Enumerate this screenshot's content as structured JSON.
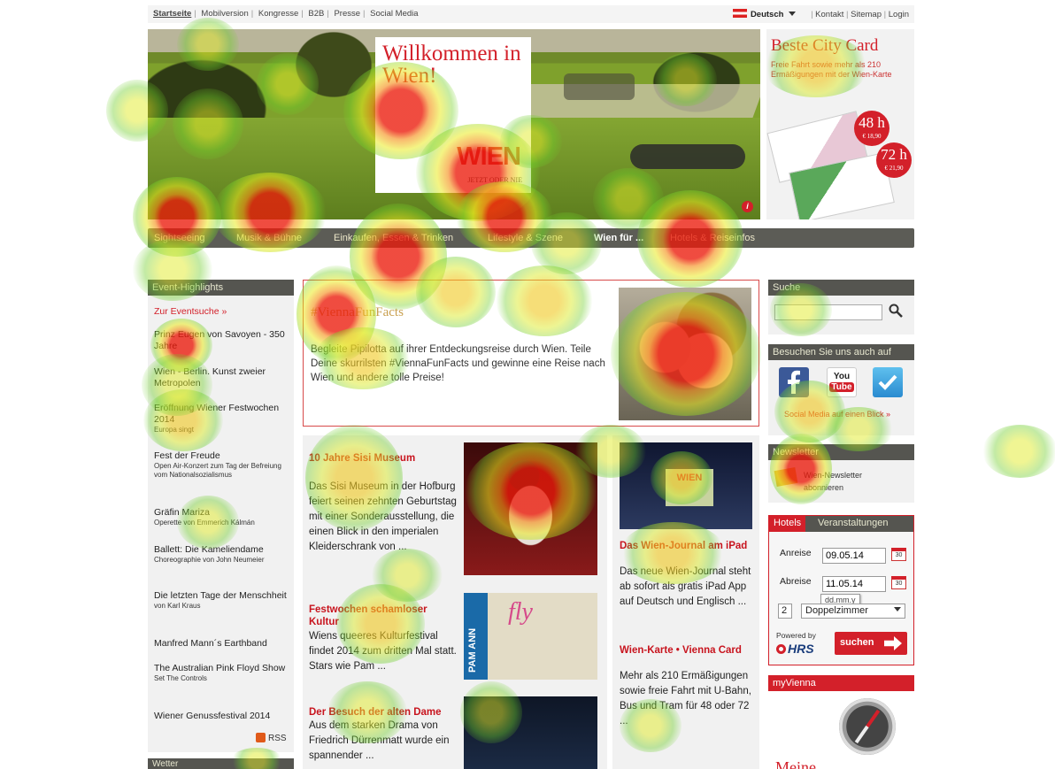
{
  "topbar": {
    "links_left": [
      "Startseite",
      "Mobilversion",
      "Kongresse",
      "B2B",
      "Presse",
      "Social Media"
    ],
    "language": "Deutsch",
    "links_right": [
      "Kontakt",
      "Sitemap",
      "Login"
    ]
  },
  "hero": {
    "welcome_title": "Willkommen in Wien!",
    "logo": "WIEN",
    "logo_sub": "JETZT ODER NIE",
    "info_icon": "i"
  },
  "citycard": {
    "title": "Beste City Card",
    "desc": "Freie Fahrt sowie mehr als 210 Ermäßigungen mit der Wien-Karte",
    "badge48": {
      "hours": "48 h",
      "price": "€ 18,90"
    },
    "badge72": {
      "hours": "72 h",
      "price": "€ 21,90"
    }
  },
  "mainnav": {
    "items": [
      "Sightseeing",
      "Musik & Bühne",
      "Einkaufen, Essen & Trinken",
      "Lifestyle & Szene",
      "Wien für ...",
      "Hotels & Reiseinfos"
    ]
  },
  "events": {
    "heading": "Event-Highlights",
    "search_link": "Zur Eventsuche »",
    "items": [
      {
        "title": "Prinz Eugen von Savoyen - 350 Jahre",
        "sub": ""
      },
      {
        "title": "Wien - Berlin. Kunst zweier Metropolen",
        "sub": ""
      },
      {
        "title": "Eröffnung Wiener Festwochen 2014",
        "sub": "Europa singt"
      },
      {
        "title": "Fest der Freude",
        "sub": "Open Air-Konzert zum Tag der Befreiung vom Nationalsozialismus"
      },
      {
        "title": "Gräfin Mariza",
        "sub": "Operette von Emmerich Kálmán"
      },
      {
        "title": "Ballett: Die Kameliendame",
        "sub": "Choreographie von John Neumeier"
      },
      {
        "title": "Die letzten Tage der Menschheit",
        "sub": "von Karl Kraus"
      },
      {
        "title": "Manfred Mann´s Earthband",
        "sub": ""
      },
      {
        "title": "The Australian Pink Floyd Show",
        "sub": "Set The Controls"
      },
      {
        "title": "Wiener Genussfestival 2014",
        "sub": ""
      }
    ],
    "rss": "RSS",
    "weather_heading": "Wetter"
  },
  "funfacts": {
    "tag": "#ViennaFunFacts",
    "text": "Begleite Pipilotta auf ihrer Entdeckungsreise durch Wien. Teile Deine skurrilsten #ViennaFunFacts und gewinne eine Reise nach Wien und andere tolle Preise!"
  },
  "articles_left": [
    {
      "title": "10 Jahre Sisi Museum",
      "body": "Das Sisi Museum in der Hofburg feiert seinen zehnten Geburtstag mit einer Sonderausstellung, die einen Blick in den imperialen Kleiderschrank von ..."
    },
    {
      "title": "Festwochen schamloser Kultur",
      "body": "Wiens queeres Kulturfestival findet 2014 zum dritten Mal statt. Stars wie Pam ..."
    },
    {
      "title": "Der Besuch der alten Dame",
      "body": "Aus dem starken Drama von Friedrich Dürrenmatt wurde ein spannender ..."
    }
  ],
  "articles_right": [
    {
      "title": "Das Wien-Journal am iPad",
      "body": "Das neue Wien-Journal steht ab sofort als gratis iPad App auf Deutsch und Englisch ...",
      "thumb_label": "WIEN"
    },
    {
      "title": "Wien-Karte • Vienna Card",
      "body": "Mehr als 210 Ermäßigungen sowie freie Fahrt mit U-Bahn, Bus und Tram für 48 oder 72 ..."
    }
  ],
  "thumb_pamann": "PAM ANN",
  "thumb_fly": "fly",
  "sidebar": {
    "search_heading": "Suche",
    "search_value": "",
    "social_heading": "Besuchen Sie uns auch auf",
    "social_link": "Social Media auf einen Blick »",
    "newsletter_heading": "Newsletter",
    "newsletter_text": "Wien-Newsletter abonnieren",
    "youtube_top": "You",
    "youtube_bottom": "Tube"
  },
  "hotels": {
    "tabs": [
      "Hotels",
      "Veranstaltungen"
    ],
    "arrival_label": "Anreise",
    "arrival_value": "09.05.14",
    "departure_label": "Abreise",
    "departure_value": "11.05.14",
    "date_hint": "dd.mm.y",
    "rooms": "2",
    "room_type": "Doppelzimmer",
    "powered_by": "Powered by",
    "hrs": "HRS",
    "submit": "suchen",
    "cal_day": "30"
  },
  "myvienna": {
    "heading": "myVienna",
    "title": "Meine"
  }
}
